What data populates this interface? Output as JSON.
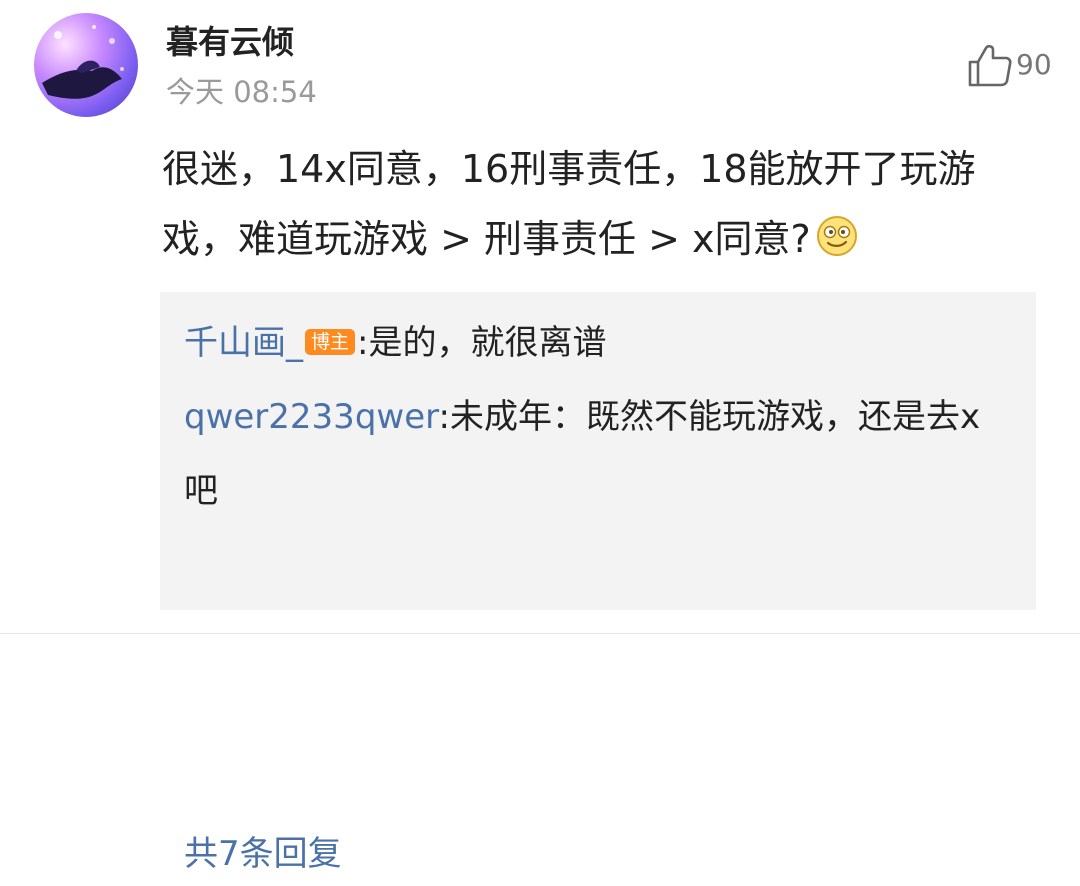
{
  "post": {
    "username": "暮有云倾",
    "timestamp": "今天 08:54",
    "like_count": "90",
    "content": "很迷，14x同意，16刑事责任，18能放开了玩游戏，难道玩游戏 > 刑事责任 > x同意?",
    "emoji": "smirk-emoji"
  },
  "replies": [
    {
      "author": "千山画_",
      "badge": "博主",
      "text": ":是的，就很离谱"
    },
    {
      "author": "qwer2233qwer",
      "text": ":未成年：既然不能玩游戏，还是去x吧"
    }
  ],
  "more_replies": "共7条回复",
  "colors": {
    "link": "#4a72a8",
    "badge": "#ff8a1f",
    "reply_bg": "#f3f3f3"
  }
}
